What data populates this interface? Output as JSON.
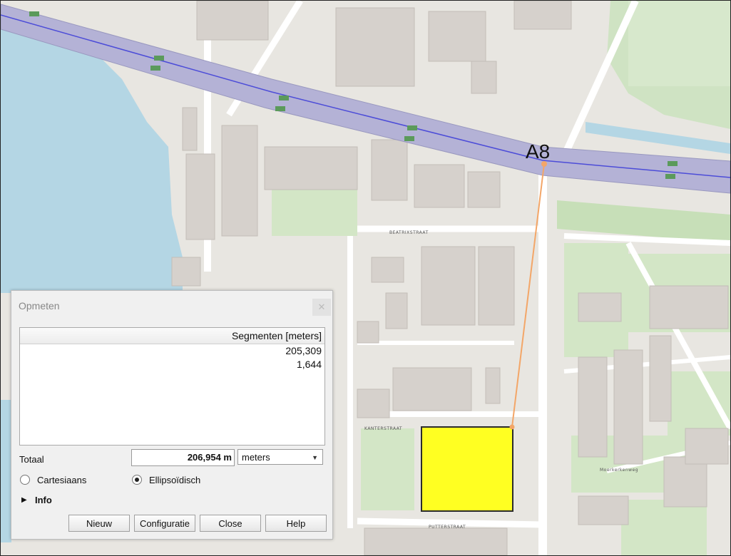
{
  "map": {
    "highway_label": "A8",
    "highway_color": "#b4b2d6",
    "route_color": "#4c4cd8",
    "measure_line_color": "#f3a668",
    "selection_fill": "#ffff22",
    "water_color": "#b4d6e4",
    "street_labels": [
      "PUTTERSTRAAT",
      "KANTERSTRAAT",
      "Moerkerkenweg",
      "BEATRIXSTRAAT"
    ]
  },
  "dialog": {
    "title": "Opmeten",
    "close_icon": "close-icon",
    "segments_header": "Segmenten [meters]",
    "segments": [
      "205,309",
      "1,644"
    ],
    "totaal_label": "Totaal",
    "total_value": "206,954 m",
    "unit_selected": "meters",
    "radio_cartesiaans": "Cartesiaans",
    "radio_ellipsoidisch": "Ellipsoïdisch",
    "ellipsoidisch_selected": true,
    "info_label": "Info",
    "buttons": {
      "nieuw": "Nieuw",
      "configuratie": "Configuratie",
      "close": "Close",
      "help": "Help"
    }
  }
}
